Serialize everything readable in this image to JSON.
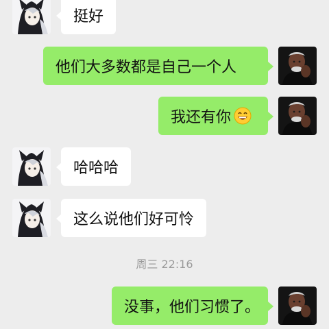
{
  "messages": [
    {
      "side": "left",
      "text": "挺好"
    },
    {
      "side": "right",
      "text": "他们大多数都是自己一个人"
    },
    {
      "side": "right",
      "text": "我还有你",
      "emoji": "grinning-face-emoji"
    },
    {
      "side": "left",
      "text": "哈哈哈"
    },
    {
      "side": "left",
      "text": "这么说他们好可怜"
    },
    {
      "side": "right",
      "text": "没事，他们习惯了。"
    }
  ],
  "timestamp": "周三 22:16",
  "colors": {
    "background": "#ededed",
    "my_bubble": "#95ec69",
    "their_bubble": "#ffffff",
    "timestamp_text": "#9a9a9a"
  },
  "avatars": {
    "left": "anime-hooded-girl-avatar",
    "right": "man-portrait-avatar"
  }
}
